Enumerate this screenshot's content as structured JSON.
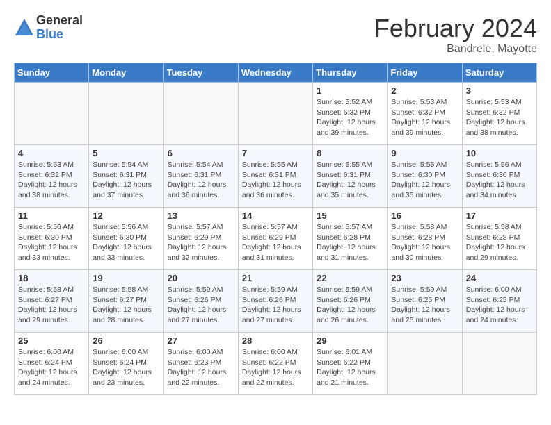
{
  "logo": {
    "general": "General",
    "blue": "Blue"
  },
  "title": "February 2024",
  "subtitle": "Bandrele, Mayotte",
  "days_header": [
    "Sunday",
    "Monday",
    "Tuesday",
    "Wednesday",
    "Thursday",
    "Friday",
    "Saturday"
  ],
  "weeks": [
    [
      {
        "day": "",
        "info": ""
      },
      {
        "day": "",
        "info": ""
      },
      {
        "day": "",
        "info": ""
      },
      {
        "day": "",
        "info": ""
      },
      {
        "day": "1",
        "info": "Sunrise: 5:52 AM\nSunset: 6:32 PM\nDaylight: 12 hours and 39 minutes."
      },
      {
        "day": "2",
        "info": "Sunrise: 5:53 AM\nSunset: 6:32 PM\nDaylight: 12 hours and 39 minutes."
      },
      {
        "day": "3",
        "info": "Sunrise: 5:53 AM\nSunset: 6:32 PM\nDaylight: 12 hours and 38 minutes."
      }
    ],
    [
      {
        "day": "4",
        "info": "Sunrise: 5:53 AM\nSunset: 6:32 PM\nDaylight: 12 hours and 38 minutes."
      },
      {
        "day": "5",
        "info": "Sunrise: 5:54 AM\nSunset: 6:31 PM\nDaylight: 12 hours and 37 minutes."
      },
      {
        "day": "6",
        "info": "Sunrise: 5:54 AM\nSunset: 6:31 PM\nDaylight: 12 hours and 36 minutes."
      },
      {
        "day": "7",
        "info": "Sunrise: 5:55 AM\nSunset: 6:31 PM\nDaylight: 12 hours and 36 minutes."
      },
      {
        "day": "8",
        "info": "Sunrise: 5:55 AM\nSunset: 6:31 PM\nDaylight: 12 hours and 35 minutes."
      },
      {
        "day": "9",
        "info": "Sunrise: 5:55 AM\nSunset: 6:30 PM\nDaylight: 12 hours and 35 minutes."
      },
      {
        "day": "10",
        "info": "Sunrise: 5:56 AM\nSunset: 6:30 PM\nDaylight: 12 hours and 34 minutes."
      }
    ],
    [
      {
        "day": "11",
        "info": "Sunrise: 5:56 AM\nSunset: 6:30 PM\nDaylight: 12 hours and 33 minutes."
      },
      {
        "day": "12",
        "info": "Sunrise: 5:56 AM\nSunset: 6:30 PM\nDaylight: 12 hours and 33 minutes."
      },
      {
        "day": "13",
        "info": "Sunrise: 5:57 AM\nSunset: 6:29 PM\nDaylight: 12 hours and 32 minutes."
      },
      {
        "day": "14",
        "info": "Sunrise: 5:57 AM\nSunset: 6:29 PM\nDaylight: 12 hours and 31 minutes."
      },
      {
        "day": "15",
        "info": "Sunrise: 5:57 AM\nSunset: 6:28 PM\nDaylight: 12 hours and 31 minutes."
      },
      {
        "day": "16",
        "info": "Sunrise: 5:58 AM\nSunset: 6:28 PM\nDaylight: 12 hours and 30 minutes."
      },
      {
        "day": "17",
        "info": "Sunrise: 5:58 AM\nSunset: 6:28 PM\nDaylight: 12 hours and 29 minutes."
      }
    ],
    [
      {
        "day": "18",
        "info": "Sunrise: 5:58 AM\nSunset: 6:27 PM\nDaylight: 12 hours and 29 minutes."
      },
      {
        "day": "19",
        "info": "Sunrise: 5:58 AM\nSunset: 6:27 PM\nDaylight: 12 hours and 28 minutes."
      },
      {
        "day": "20",
        "info": "Sunrise: 5:59 AM\nSunset: 6:26 PM\nDaylight: 12 hours and 27 minutes."
      },
      {
        "day": "21",
        "info": "Sunrise: 5:59 AM\nSunset: 6:26 PM\nDaylight: 12 hours and 27 minutes."
      },
      {
        "day": "22",
        "info": "Sunrise: 5:59 AM\nSunset: 6:26 PM\nDaylight: 12 hours and 26 minutes."
      },
      {
        "day": "23",
        "info": "Sunrise: 5:59 AM\nSunset: 6:25 PM\nDaylight: 12 hours and 25 minutes."
      },
      {
        "day": "24",
        "info": "Sunrise: 6:00 AM\nSunset: 6:25 PM\nDaylight: 12 hours and 24 minutes."
      }
    ],
    [
      {
        "day": "25",
        "info": "Sunrise: 6:00 AM\nSunset: 6:24 PM\nDaylight: 12 hours and 24 minutes."
      },
      {
        "day": "26",
        "info": "Sunrise: 6:00 AM\nSunset: 6:24 PM\nDaylight: 12 hours and 23 minutes."
      },
      {
        "day": "27",
        "info": "Sunrise: 6:00 AM\nSunset: 6:23 PM\nDaylight: 12 hours and 22 minutes."
      },
      {
        "day": "28",
        "info": "Sunrise: 6:00 AM\nSunset: 6:22 PM\nDaylight: 12 hours and 22 minutes."
      },
      {
        "day": "29",
        "info": "Sunrise: 6:01 AM\nSunset: 6:22 PM\nDaylight: 12 hours and 21 minutes."
      },
      {
        "day": "",
        "info": ""
      },
      {
        "day": "",
        "info": ""
      }
    ]
  ]
}
